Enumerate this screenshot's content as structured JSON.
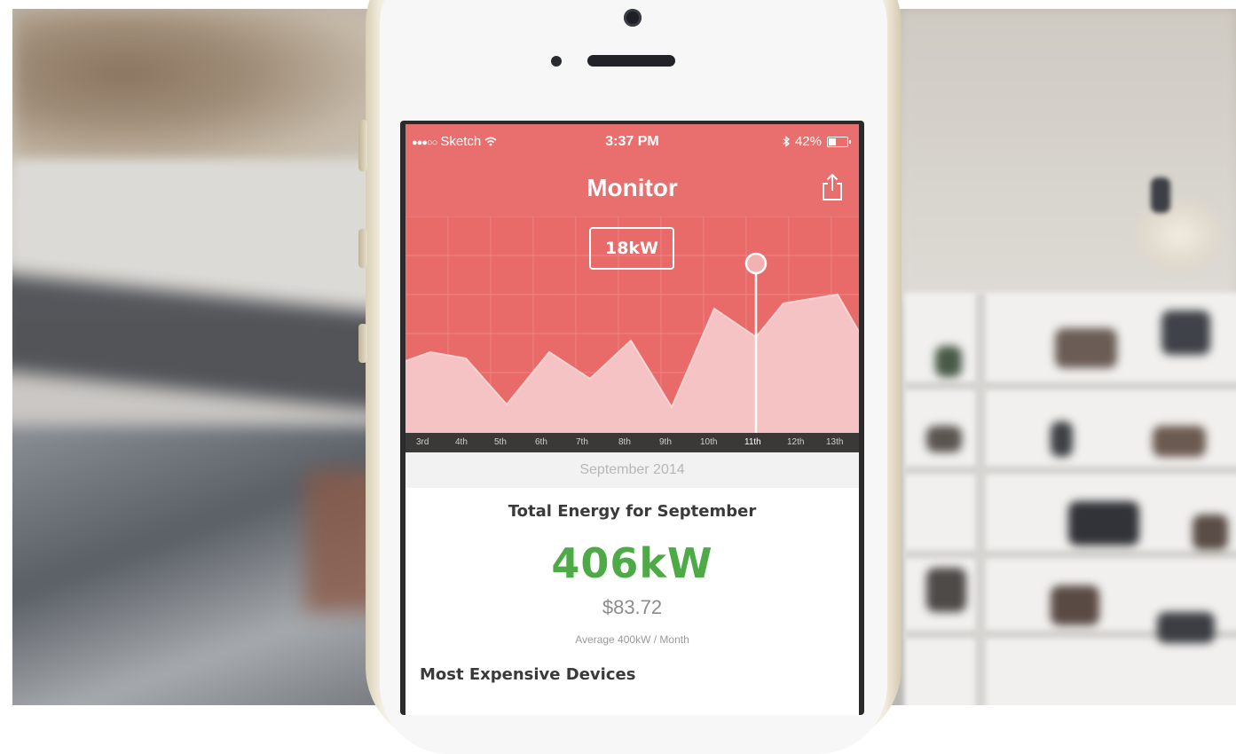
{
  "status_bar": {
    "signal": "●●●○○",
    "carrier": "Sketch",
    "time": "3:37 PM",
    "battery": "42%",
    "battery_level": 0.42
  },
  "navbar": {
    "title": "Monitor",
    "share_icon": "share-icon"
  },
  "chart_data": {
    "type": "area",
    "x": [
      "3rd",
      "4th",
      "5th",
      "6th",
      "7th",
      "8th",
      "9th",
      "10th",
      "11th",
      "12th",
      "13th"
    ],
    "selected_index": 8,
    "selected_label": "18kW",
    "colors": {
      "background": "#e86b6a",
      "fill": "#f5c3c3",
      "line": "#f6d4d4"
    }
  },
  "month_label": "September 2014",
  "summary": {
    "title": "Total Energy for September",
    "value": "406kW",
    "cost": "$83.72",
    "average": "Average 400kW / Month"
  },
  "devices": {
    "title": "Most Expensive Devices"
  },
  "colors": {
    "accent": "#e86f6e",
    "positive": "#4daa46"
  }
}
